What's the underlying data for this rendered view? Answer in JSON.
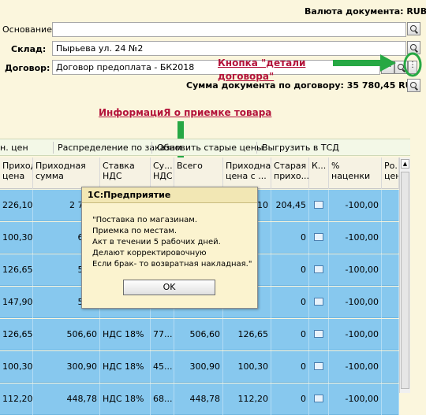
{
  "header": {
    "currency_label": "Валюта документа: RUB",
    "basis_label": "Основание:",
    "basis_value": "",
    "warehouse_label": "Склад:",
    "warehouse_value": "Пырьева ул. 24 №2",
    "contract_label": "Договор:",
    "contract_value": "Договор предоплата - БК2018",
    "sum_label": "Сумма документа по договору: 35 780,45 RUB"
  },
  "annotations": {
    "details_button_line1": "Кнопка \"детали",
    "details_button_line2": "договора\"",
    "info_title": "ИнформациЯ  о приемке товара",
    "arrow_color": "#27a844"
  },
  "toolbar": {
    "items": [
      "н. цен",
      "Распределение по заказам",
      "Обновить старые цены",
      "Выгрузить в ТСД"
    ]
  },
  "table": {
    "columns": [
      "Приходн... цена",
      "Приходная сумма",
      "Ставка НДС",
      "Су... НДС",
      "Всего",
      "Приходная цена с ...",
      "Старая прихо...",
      "К...",
      "% наценки",
      "Ро... цен"
    ],
    "rows": [
      [
        "226,10",
        "2 71...",
        "",
        "",
        "",
        "10",
        "204,45",
        "",
        "-100,00"
      ],
      [
        "100,30",
        "60...",
        "",
        "",
        "",
        "",
        "0",
        "",
        "-100,00"
      ],
      [
        "126,65",
        "50...",
        "",
        "",
        "",
        "",
        "0",
        "",
        "-100,00"
      ],
      [
        "147,90",
        "59...",
        "",
        "",
        "",
        "",
        "0",
        "",
        "-100,00"
      ],
      [
        "126,65",
        "506,60",
        "НДС 18%",
        "77...",
        "506,60",
        "126,65",
        "0",
        "",
        "-100,00"
      ],
      [
        "100,30",
        "300,90",
        "НДС 18%",
        "45...",
        "300,90",
        "100,30",
        "0",
        "",
        "-100,00"
      ],
      [
        "112,20",
        "448,78",
        "НДС 18%",
        "68...",
        "448,78",
        "112,20",
        "0",
        "",
        "-100,00"
      ]
    ]
  },
  "dialog": {
    "title": "1С:Предприятие",
    "lines": [
      "\"Поставка по магазинам.",
      "Приемка по местам.",
      "Акт в течении 5 рабочих дней.",
      "Делают корректировочную",
      "Если брак- то возвратная накладная.\""
    ],
    "ok_label": "OK"
  }
}
